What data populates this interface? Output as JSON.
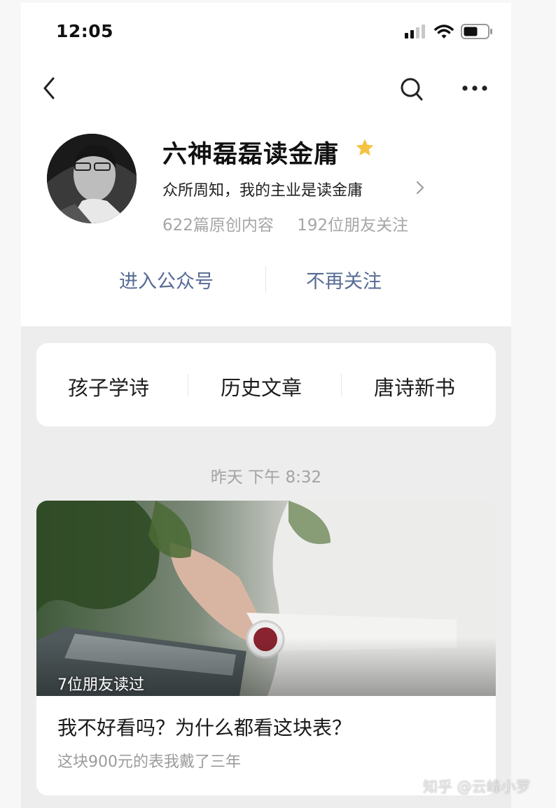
{
  "status_bar": {
    "time": "12:05"
  },
  "account": {
    "name": "六神磊磊读金庸",
    "description": "众所周知，我的主业是读金庸",
    "original_count": "622篇原创内容",
    "followers": "192位朋友关注"
  },
  "actions": {
    "enter": "进入公众号",
    "unfollow": "不再关注"
  },
  "menu": {
    "items": [
      "孩子学诗",
      "历史文章",
      "唐诗新书"
    ]
  },
  "feed": {
    "timestamp": "昨天 下午 8:32",
    "article": {
      "read_count": "7位朋友读过",
      "title": "我不好看吗？为什么都看这块表？",
      "summary": "这块900元的表我戴了三年"
    }
  },
  "watermark": "知乎 @云峰小罗",
  "colors": {
    "link_blue": "#566b94",
    "star": "#f5c242",
    "muted": "#a6a6a6"
  }
}
